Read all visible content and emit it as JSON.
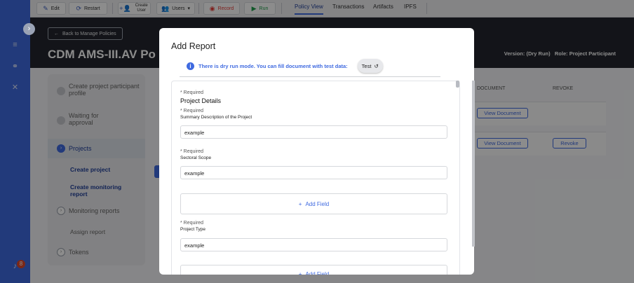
{
  "toolbar": {
    "edit": "Edit",
    "restart": "Restart",
    "create_user": "Create User",
    "users": "Users",
    "record": "Record",
    "run": "Run",
    "tabs": [
      "Policy View",
      "Transactions",
      "Artifacts",
      "IPFS"
    ]
  },
  "header": {
    "back": "Back to Manage Policies",
    "title": "CDM AMS-III.AV Po",
    "version": "Version: (Dry Run)",
    "role": "Role: Project Participant"
  },
  "steps": {
    "s1": "Create project participant profile",
    "s2": "Waiting for approval",
    "s3": "Projects",
    "sub1": "Create project",
    "sub2": "Create monitoring report",
    "s4": "Monitoring reports",
    "sub3": "Assign report",
    "s5": "Tokens"
  },
  "table": {
    "col_document": "DOCUMENT",
    "col_revoke": "REVOKE",
    "view_document": "View Document",
    "revoke": "Revoke"
  },
  "rail": {
    "badge": "8"
  },
  "modal": {
    "title": "Add Report",
    "dry_run_text": "There is dry run mode. You can fill document with test data:",
    "test_label": "Test",
    "required": "* Required",
    "section_title": "Project Details",
    "field1_label": "Summary Description of the Project",
    "field1_value": "example",
    "field2_label": "Sectoral Scope",
    "field2_value": "example",
    "add_field": "Add Field",
    "field3_label": "Project Type",
    "field3_value": "example"
  },
  "colors": {
    "accent": "#3f6ae0",
    "header_bg": "#23262e",
    "record": "#e53935",
    "run": "#1e9e4a"
  },
  "icons": [
    "pencil-icon",
    "restart-icon",
    "add-user-icon",
    "users-icon",
    "record-icon",
    "play-icon",
    "arrow-left-icon",
    "info-icon",
    "history-icon",
    "plus-icon"
  ]
}
